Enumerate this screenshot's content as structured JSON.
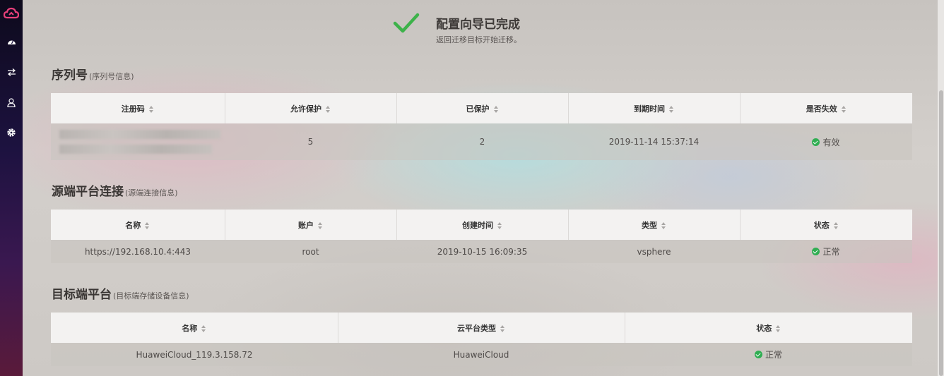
{
  "completion": {
    "title": "配置向导已完成",
    "subtitle": "返回迁移目标开始迁移。"
  },
  "serial": {
    "title": "序列号",
    "subtitle": "(序列号信息)",
    "columns": [
      "注册码",
      "允许保护",
      "已保护",
      "到期时间",
      "是否失效"
    ],
    "row": {
      "protect_allowed": "5",
      "protected": "2",
      "expire_time": "2019-11-14 15:37:14",
      "status": "有效"
    }
  },
  "source": {
    "title": "源端平台连接",
    "subtitle": "(源端连接信息)",
    "columns": [
      "名称",
      "账户",
      "创建时间",
      "类型",
      "状态"
    ],
    "row": {
      "name": "https://192.168.10.4:443",
      "account": "root",
      "created": "2019-10-15 16:09:35",
      "type": "vsphere",
      "status": "正常"
    }
  },
  "target": {
    "title": "目标端平台",
    "subtitle": "(目标端存储设备信息)",
    "columns": [
      "名称",
      "云平台类型",
      "状态"
    ],
    "row": {
      "name": "HuaweiCloud_119.3.158.72",
      "platform": "HuaweiCloud",
      "status": "正常"
    }
  },
  "sidebar": {
    "icons": [
      "cloud-logo-icon",
      "dashboard-icon",
      "transfer-icon",
      "user-icon",
      "gear-icon"
    ]
  },
  "colors": {
    "success": "#2fae52",
    "check": "#3db24a",
    "brand": "#e8407a"
  }
}
